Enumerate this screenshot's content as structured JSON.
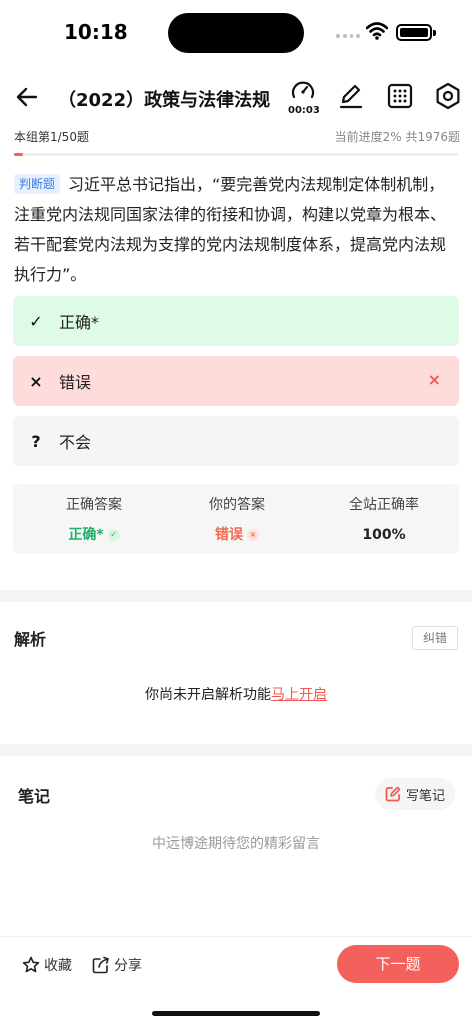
{
  "status_bar": {
    "time": "10:18"
  },
  "nav": {
    "title": "（2022）政策与法律法规",
    "timer": "00:03",
    "icons": [
      "back-arrow-icon",
      "timer-icon",
      "pen-icon",
      "grid-icon",
      "settings-icon"
    ]
  },
  "progress": {
    "group_label": "本组第1/50题",
    "progress_text": "当前进度2%  共1976题",
    "percent": 2
  },
  "question": {
    "tag": "判断题",
    "text": "习近平总书记指出，“要完善党内法规制定体制机制，注重党内法规同国家法律的衔接和协调，构建以党章为根本、若干配套党内法规为支撑的党内法规制度体系，提高党内法规执行力”。"
  },
  "options": [
    {
      "mark": "✓",
      "label": "正确*",
      "state": "correct"
    },
    {
      "mark": "×",
      "label": "错误",
      "state": "selected-wrong",
      "indicator": "×"
    },
    {
      "mark": "?",
      "label": "不会",
      "state": "neutral"
    }
  ],
  "result": {
    "correct_answer_label": "正确答案",
    "correct_answer_value": "正确*",
    "your_answer_label": "你的答案",
    "your_answer_value": "错误",
    "site_rate_label": "全站正确率",
    "site_rate_value": "100%"
  },
  "analysis": {
    "title": "解析",
    "report_label": "纠错",
    "message": "你尚未开启解析功能",
    "link_text": "马上开启"
  },
  "notes": {
    "title": "笔记",
    "write_label": "写笔记",
    "empty_text": "中远博途期待您的精彩留言"
  },
  "bottom_bar": {
    "favorite_label": "收藏",
    "share_label": "分享",
    "next_label": "下一题"
  },
  "colors": {
    "accent": "#f4605c",
    "correct_bg": "#ddfbe7",
    "wrong_bg": "#ffdcdc",
    "neutral_bg": "#f5f5f5",
    "correct_text": "#1fb16a",
    "wrong_text": "#f06a4e"
  }
}
